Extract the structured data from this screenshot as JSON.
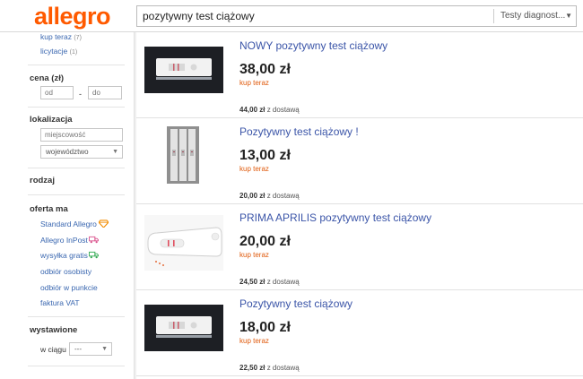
{
  "header": {
    "logo": "allegro",
    "search_value": "pozytywny test ciążowy",
    "search_category": "Testy diagnost..."
  },
  "sidebar": {
    "top_links": [
      {
        "label": "kup teraz",
        "count": "(7)"
      },
      {
        "label": "licytacje",
        "count": "(1)"
      }
    ],
    "price": {
      "title": "cena (zł)",
      "from_placeholder": "od",
      "to_placeholder": "do",
      "dash": "-"
    },
    "location": {
      "title": "lokalizacja",
      "city_placeholder": "miejscowość",
      "region_value": "województwo"
    },
    "rodzaj_title": "rodzaj",
    "offer": {
      "title": "oferta ma",
      "items": [
        {
          "label": "Standard Allegro",
          "icon": "diamond-icon"
        },
        {
          "label": "Allegro InPost",
          "icon": "inpost-truck-icon"
        },
        {
          "label": "wysyłka gratis",
          "icon": "free-shipping-truck-icon"
        },
        {
          "label": "odbiór osobisty"
        },
        {
          "label": "odbiór w punkcie"
        },
        {
          "label": "faktura VAT"
        }
      ]
    },
    "listed": {
      "title": "wystawione",
      "label": "w ciągu",
      "value": "---"
    }
  },
  "results": [
    {
      "title": "NOWY pozytywny test ciążowy",
      "price": "38,00 zł",
      "buy_type": "kup teraz",
      "shipping_price": "44,00 zł",
      "shipping_suffix": "z dostawą"
    },
    {
      "title": "Pozytywny test ciążowy !",
      "price": "13,00 zł",
      "buy_type": "kup teraz",
      "shipping_price": "20,00 zł",
      "shipping_suffix": "z dostawą"
    },
    {
      "title": "PRIMA APRILIS pozytywny test ciążowy",
      "price": "20,00 zł",
      "buy_type": "kup teraz",
      "shipping_price": "24,50 zł",
      "shipping_suffix": "z dostawą"
    },
    {
      "title": "Pozytywny test ciążowy",
      "price": "18,00 zł",
      "buy_type": "kup teraz",
      "shipping_price": "22,50 zł",
      "shipping_suffix": "z dostawą"
    }
  ],
  "colors": {
    "brand": "#ff5a00",
    "link": "#3b55a8",
    "kup_teraz": "#e05a0c"
  }
}
